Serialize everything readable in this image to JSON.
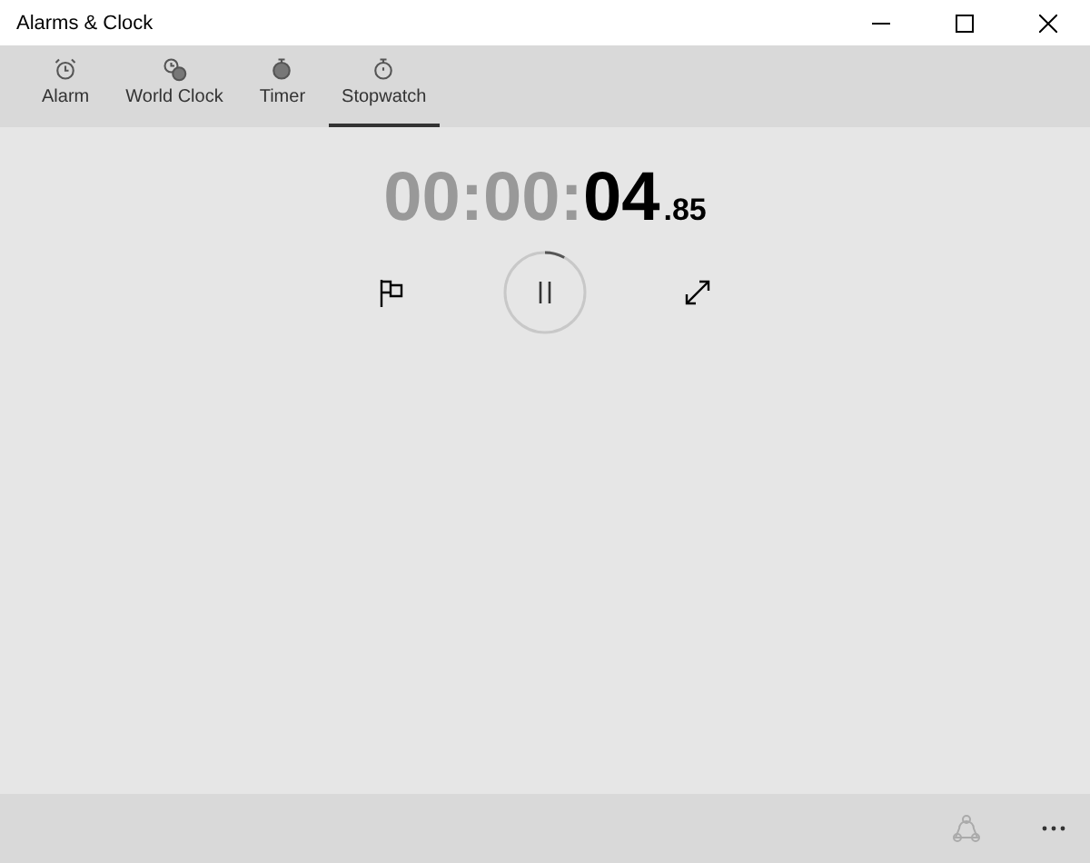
{
  "window": {
    "title": "Alarms & Clock"
  },
  "tabs": [
    {
      "label": "Alarm",
      "kind": "alarm",
      "selected": false
    },
    {
      "label": "World Clock",
      "kind": "world",
      "selected": false
    },
    {
      "label": "Timer",
      "kind": "timer",
      "selected": false
    },
    {
      "label": "Stopwatch",
      "kind": "stopwatch",
      "selected": true
    }
  ],
  "stopwatch": {
    "elapsed_inactive": "00:00:",
    "seconds": "04",
    "fraction": ".85",
    "running": true,
    "level": 0.08
  }
}
